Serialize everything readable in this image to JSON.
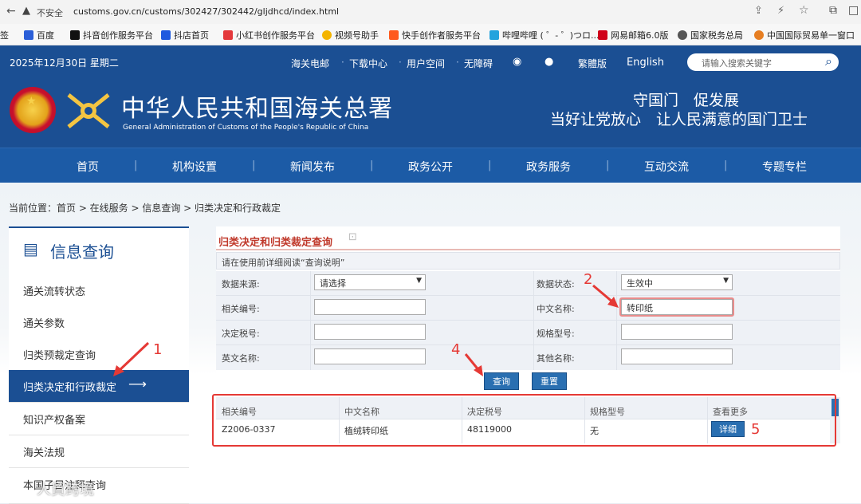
{
  "browser": {
    "security": "不安全",
    "url": "customs.gov.cn/customs/302427/302442/gljdhcd/index.html",
    "bookmarks": [
      "签",
      "百度",
      "抖音创作服务平台",
      "抖店首页",
      "小红书创作服务平台",
      "视频号助手",
      "快手创作者服务平台",
      "哔哩哔哩 ( ゜- ゜)つロ...",
      "网易邮箱6.0版",
      "国家税务总局",
      "中国国际贸易单一窗口"
    ]
  },
  "header": {
    "date": "2025年12月30日 星期二",
    "links": [
      "海关电邮",
      "下载中心",
      "用户空间",
      "无障碍",
      "繁體版",
      "English"
    ],
    "search_placeholder": "请输入搜索关键字",
    "title_cn": "中华人民共和国海关总署",
    "title_en": "General Administration of Customs of the People's Republic of China",
    "slogan1": "守国门　促发展",
    "slogan2": "当好让党放心　让人民满意的国门卫士"
  },
  "nav": [
    "首页",
    "机构设置",
    "新闻发布",
    "政务公开",
    "政务服务",
    "互动交流",
    "专题专栏"
  ],
  "breadcrumb": "当前位置：首页 > 在线服务 > 信息查询 > 归类决定和行政裁定",
  "sidebar": {
    "title": "信息查询",
    "items": [
      "通关流转状态",
      "通关参数",
      "归类预裁定查询",
      "归类决定和行政裁定",
      "知识产权备案",
      "海关法规",
      "本国子目注释查询"
    ]
  },
  "form": {
    "title": "归类决定和归类裁定查询",
    "note": "请在使用前详细阅读“查询说明”",
    "fields": {
      "source_label": "数据来源:",
      "source_value": "请选择",
      "status_label": "数据状态:",
      "status_value": "生效中",
      "related_label": "相关编号:",
      "related_value": "",
      "cn_label": "中文名称:",
      "cn_value": "转印纸",
      "tax_label": "决定税号:",
      "tax_value": "",
      "model_label": "规格型号:",
      "model_value": "",
      "en_label": "英文名称:",
      "en_value": "",
      "other_label": "其他名称:",
      "other_value": ""
    },
    "query_btn": "查询",
    "reset_btn": "重置"
  },
  "table": {
    "headers": [
      "相关编号",
      "中文名称",
      "决定税号",
      "规格型号",
      "查看更多"
    ],
    "rows": [
      [
        "Z2006-0337",
        "植绒转印纸",
        "48119000",
        "无",
        "详细"
      ]
    ]
  },
  "annotations": [
    "1",
    "2",
    "4",
    "5"
  ],
  "watermark": "人貿跨境",
  "colors": {
    "header_blue": "#1b4f93",
    "nav_blue": "#1c5ba6",
    "active_side": "#1b4f93",
    "annotation_red": "#e53935",
    "title_red": "#c0392b"
  }
}
